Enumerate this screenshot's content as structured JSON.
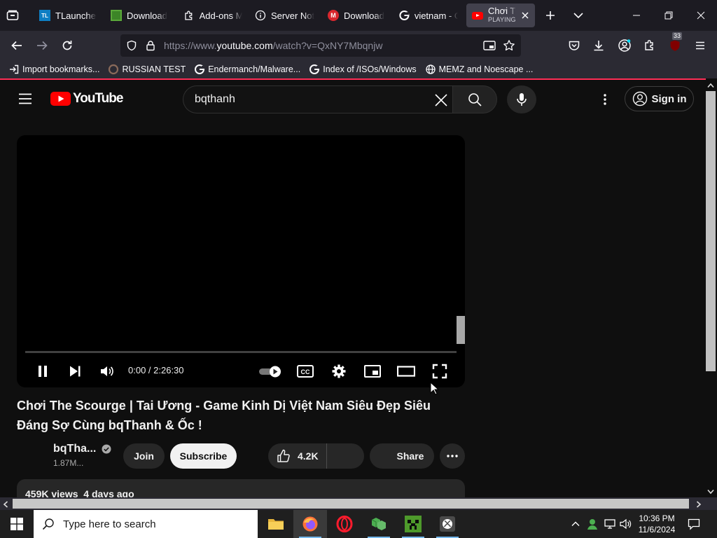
{
  "browser": {
    "tabs": [
      {
        "label": "TLauncher"
      },
      {
        "label": "Download"
      },
      {
        "label": "Add-ons M"
      },
      {
        "label": "Server Not"
      },
      {
        "label": "Download"
      },
      {
        "label": "vietnam - G"
      },
      {
        "label": "Chơi The",
        "sublabel": "PLAYING"
      }
    ],
    "url": {
      "prefix": "https://www.",
      "domain": "youtube.com",
      "rest": "/watch?v=QxNY7Mbqnjw"
    },
    "extension_badge": "33",
    "bookmarks": [
      {
        "label": "Import bookmarks...",
        "icon": "import-icon"
      },
      {
        "label": "RUSSIAN TEST",
        "icon": "bookmark-favicon"
      },
      {
        "label": "Endermanch/Malware...",
        "icon": "google-icon"
      },
      {
        "label": "Index of /ISOs/Windows",
        "icon": "google-icon"
      },
      {
        "label": "MEMZ and Noescape ...",
        "icon": "globe-icon"
      }
    ],
    "accent_color": "#ff2d55"
  },
  "youtube": {
    "logo_text": "YouTube",
    "search_query": "bqthanh",
    "signin_label": "Sign in",
    "player": {
      "time": "0:00 / 2:26:30",
      "progress_fraction": 0
    },
    "video_title": "Chơi The Scourge | Tai Ương - Game Kinh Dị Việt Nam Siêu Đẹp Siêu Đáng Sợ Cùng bqThanh & Ốc !",
    "channel": {
      "name": "bqTha...",
      "subscribers": "1.87M..."
    },
    "buttons": {
      "join": "Join",
      "subscribe": "Subscribe",
      "likes": "4.2K",
      "share": "Share"
    },
    "description_meta": "459K views  4 days ago",
    "brand_red": "#ff0000"
  },
  "taskbar": {
    "search_placeholder": "Type here to search",
    "time": "10:36 PM",
    "date": "11/6/2024"
  }
}
